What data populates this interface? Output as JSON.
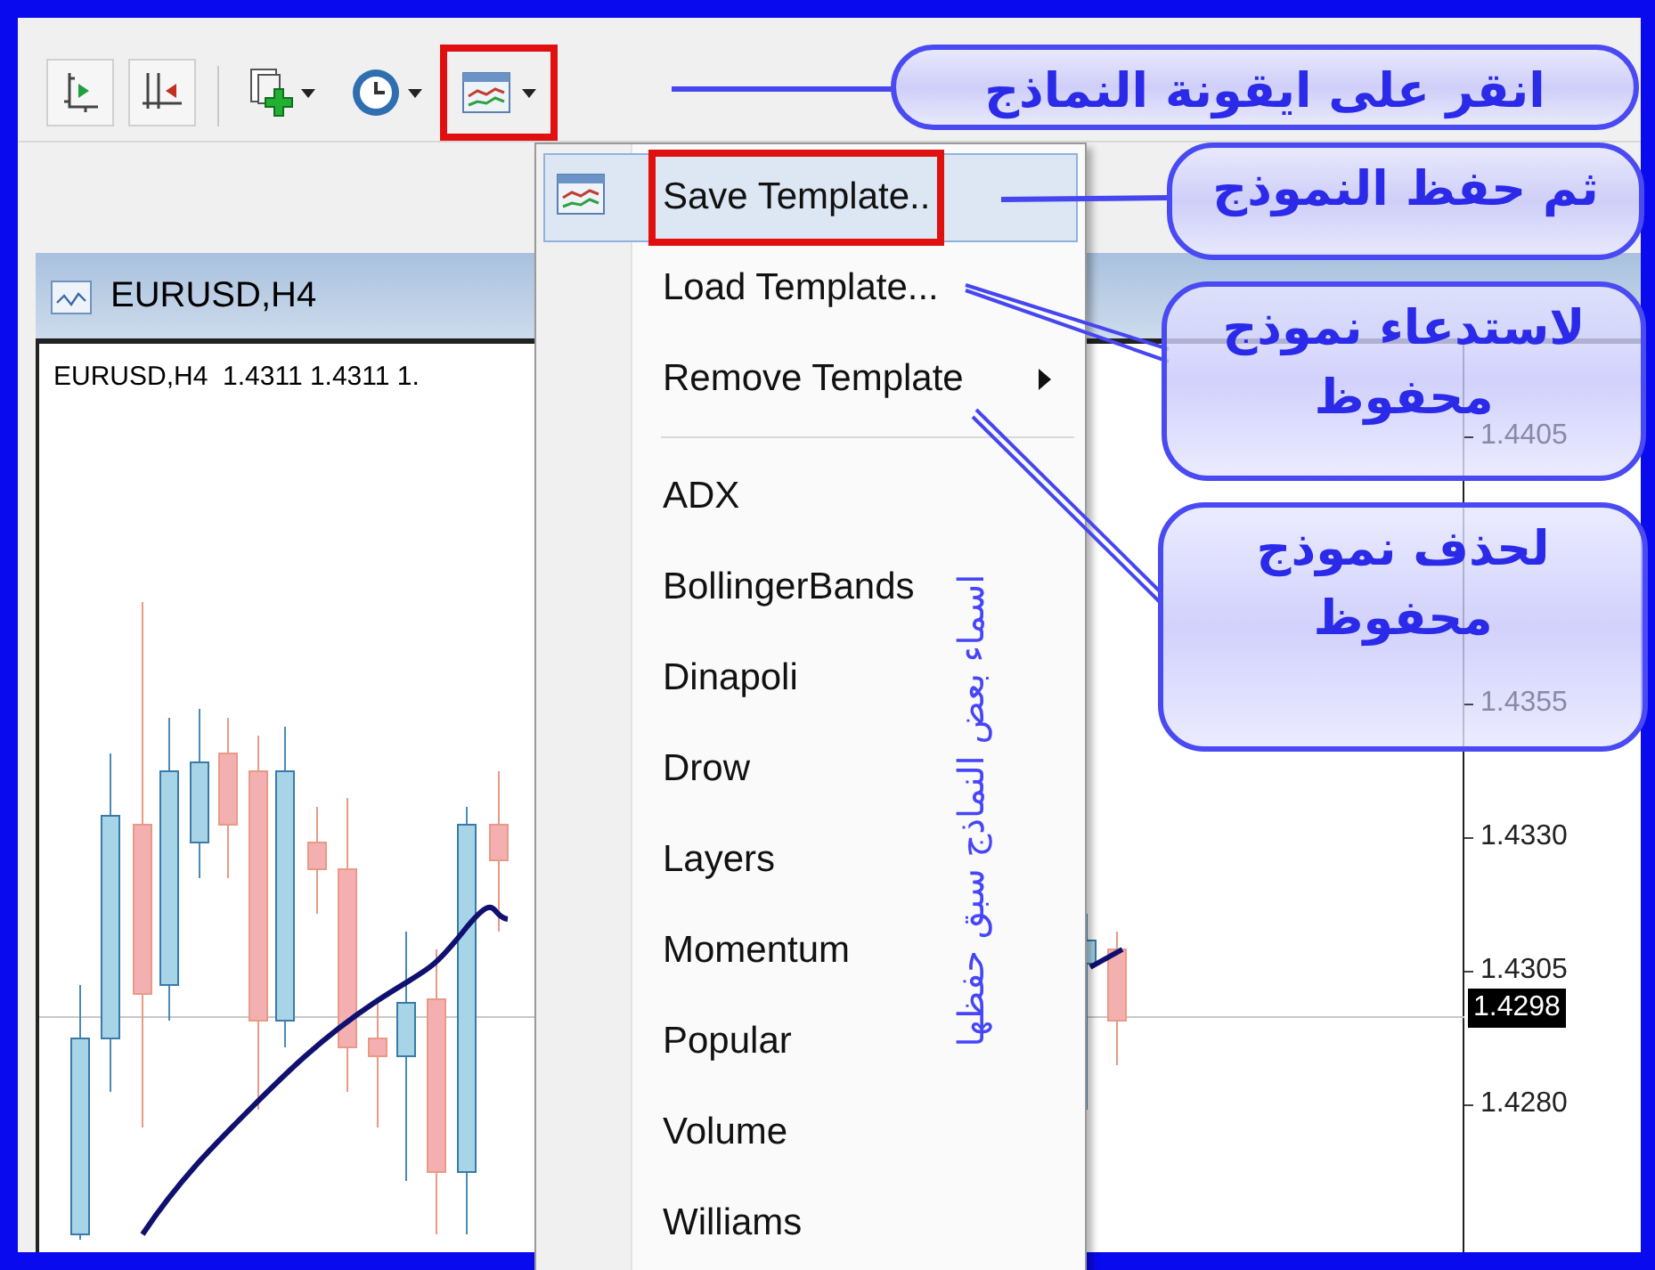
{
  "chart_window": {
    "title": "EURUSD,H4",
    "info": "EURUSD,H4  1.4311 1.4311 1.",
    "price_axis": [
      "1.4405",
      "1.4355",
      "1.4330",
      "1.4305",
      "1.4280"
    ],
    "current_price": "1.4298"
  },
  "template_menu": {
    "items": [
      {
        "kind": "item",
        "label": "Save Template..",
        "selected": true,
        "submenu": false,
        "icon": true
      },
      {
        "kind": "item",
        "label": "Load Template...",
        "selected": false,
        "submenu": false,
        "icon": false
      },
      {
        "kind": "item",
        "label": "Remove Template",
        "selected": false,
        "submenu": true,
        "icon": false
      },
      {
        "kind": "separator"
      },
      {
        "kind": "item",
        "label": "ADX",
        "selected": false,
        "submenu": false,
        "icon": false
      },
      {
        "kind": "item",
        "label": "BollingerBands",
        "selected": false,
        "submenu": false,
        "icon": false
      },
      {
        "kind": "item",
        "label": "Dinapoli",
        "selected": false,
        "submenu": false,
        "icon": false
      },
      {
        "kind": "item",
        "label": "Drow",
        "selected": false,
        "submenu": false,
        "icon": false
      },
      {
        "kind": "item",
        "label": "Layers",
        "selected": false,
        "submenu": false,
        "icon": false
      },
      {
        "kind": "item",
        "label": "Momentum",
        "selected": false,
        "submenu": false,
        "icon": false
      },
      {
        "kind": "item",
        "label": "Popular",
        "selected": false,
        "submenu": false,
        "icon": false
      },
      {
        "kind": "item",
        "label": "Volume",
        "selected": false,
        "submenu": false,
        "icon": false
      },
      {
        "kind": "item",
        "label": "Williams",
        "selected": false,
        "submenu": false,
        "icon": false
      }
    ]
  },
  "annotations": {
    "callouts": [
      {
        "text": "انقر على ايقونة النماذج"
      },
      {
        "text": "ثم حفظ النموذج"
      },
      {
        "text": "لاستدعاء نموذج محفوظ"
      },
      {
        "text": "لحذف نموذج محفوظ"
      }
    ],
    "vertical_note": "اسماء بعض النماذج سبق حفظها"
  }
}
